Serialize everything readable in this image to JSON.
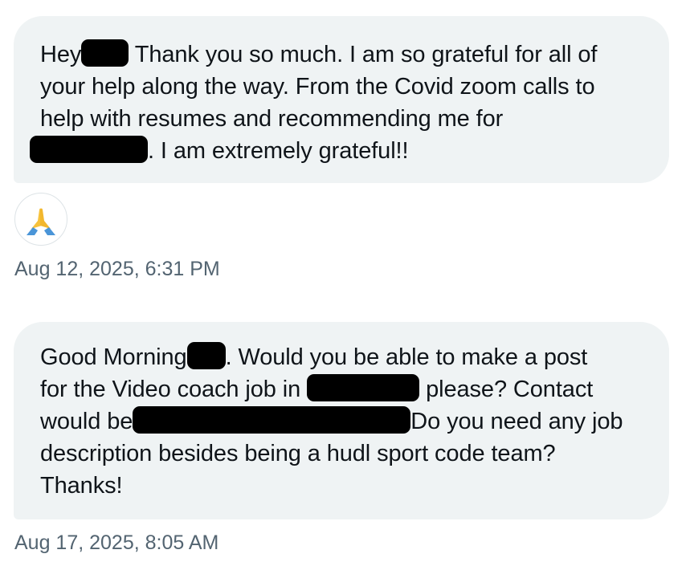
{
  "messages": [
    {
      "line1_a": "Hey",
      "line1_b": " Thank you so much. I am so grateful for all of",
      "line2": "your help along the way. From the Covid zoom calls to",
      "line3": "help with resumes and recommending me for",
      "line4_b": ". I am extremely grateful!!",
      "reaction_icon": "folded-hands-emoji",
      "timestamp": "Aug 12, 2025, 6:31 PM"
    },
    {
      "line1_a": "Good Morning",
      "line1_b": ". Would you be able to make a post",
      "line2_a": "for the Video coach job in",
      "line2_b": "please? Contact",
      "line3_a": "would be",
      "line3_b": "Do you need any job",
      "line4": "description besides being a hudl sport code team?",
      "line5": "Thanks!",
      "timestamp": "Aug 17, 2025, 8:05 AM"
    }
  ],
  "colors": {
    "bubble": "#eff3f4",
    "text": "#0f1419",
    "timestamp": "#536471",
    "redaction": "#000000"
  }
}
